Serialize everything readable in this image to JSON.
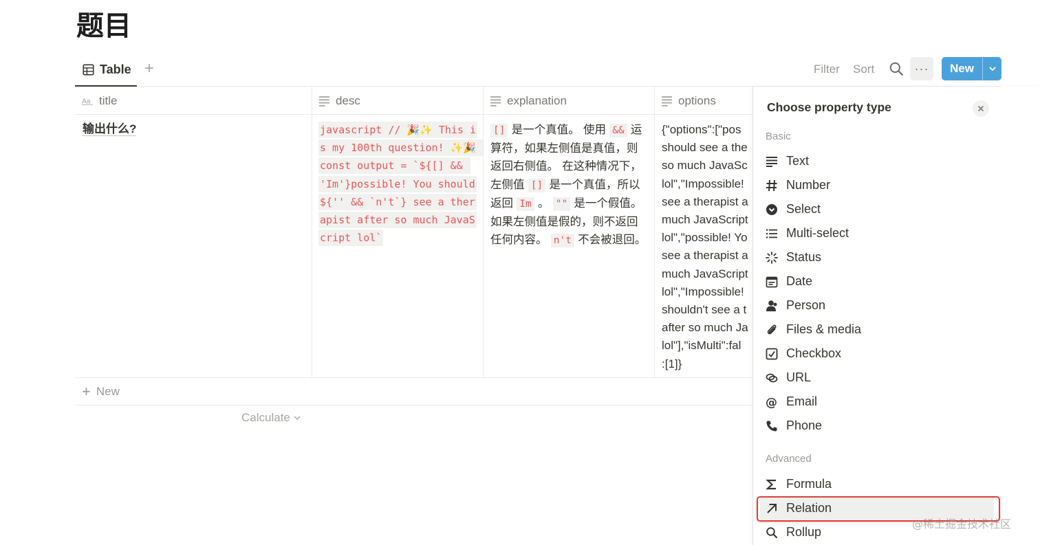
{
  "page": {
    "title": "题目"
  },
  "view": {
    "tab_label": "Table",
    "filter_label": "Filter",
    "sort_label": "Sort",
    "new_label": "New",
    "more_label": "···"
  },
  "table": {
    "columns": [
      "title",
      "desc",
      "explanation",
      "options"
    ],
    "row": {
      "title": "输出什么?",
      "desc_code": "javascript // 🎉✨ This is my 100th question! ✨🎉 const output = `${[] && 'Im'}possible! You should${'' && `n't`} see a therapist after so much JavaScript lol`",
      "explanation": [
        {
          "code": "[]"
        },
        {
          "text": " 是一个真值。 使用 "
        },
        {
          "code": "&&"
        },
        {
          "text": " 运算符，如果左侧值是真值，则返回右侧值。 在这种情况下，左侧值 "
        },
        {
          "code": "[]"
        },
        {
          "text": " 是一个真值，所以返回 "
        },
        {
          "code": "Im"
        },
        {
          "text": " 。 "
        },
        {
          "code": "\"\""
        },
        {
          "text": " 是一个假值。 如果左侧值是假的，则不返回任何内容。 "
        },
        {
          "code": "n't"
        },
        {
          "text": " 不会被退回。"
        }
      ],
      "options_lines": [
        "{\"options\":[\"pos",
        "should see a the",
        "so much JavaSc",
        "lol\",\"Impossible!",
        "see a therapist a",
        "much JavaScript",
        "lol\",\"possible! Yo",
        "see a therapist a",
        "much JavaScript",
        "lol\",\"Impossible!",
        "shouldn't see a t",
        "after so much Ja",
        "lol\"],\"isMulti\":fal",
        ":[1]}"
      ]
    },
    "new_row_label": "New",
    "calculate_label": "Calculate"
  },
  "panel": {
    "title": "Choose property type",
    "basic_label": "Basic",
    "advanced_label": "Advanced",
    "basic_types": [
      "Text",
      "Number",
      "Select",
      "Multi-select",
      "Status",
      "Date",
      "Person",
      "Files & media",
      "Checkbox",
      "URL",
      "Email",
      "Phone"
    ],
    "advanced_types": [
      "Formula",
      "Relation",
      "Rollup"
    ],
    "highlighted_type": "Relation",
    "highlight_color": "#e03e35"
  },
  "watermark": "@稀土掘金技术社区",
  "colors": {
    "accent": "#4ba2da",
    "code_text": "#eb5757",
    "code_bg": "#f1f1ef"
  }
}
